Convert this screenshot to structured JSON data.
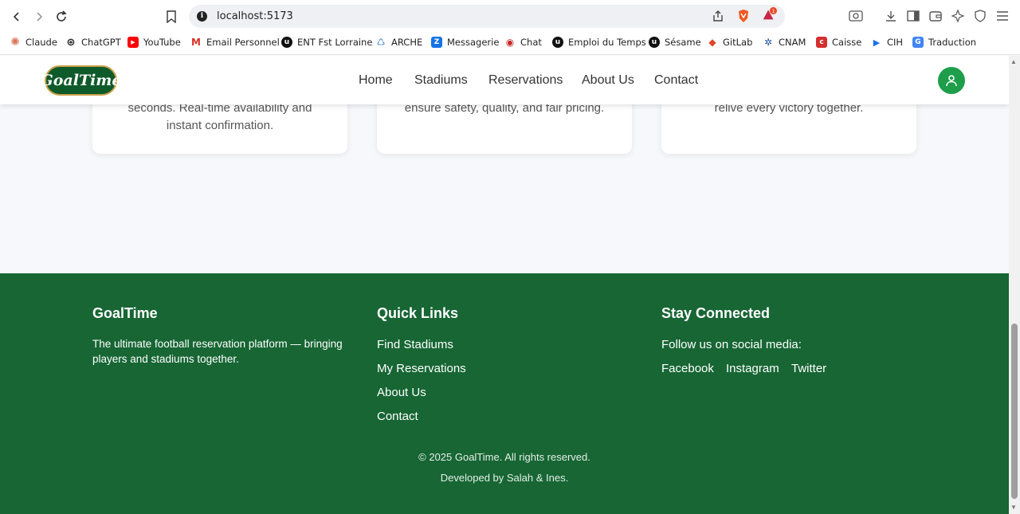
{
  "browser": {
    "url": "localhost:5173",
    "bookmarks": [
      "Claude",
      "ChatGPT",
      "YouTube",
      "Email Personnel",
      "ENT Fst Lorraine",
      "ARCHE",
      "Messagerie",
      "Chat",
      "Emploi du Temps",
      "Sésame",
      "GitLab",
      "CNAM",
      "Caisse",
      "CIH",
      "Traduction"
    ]
  },
  "header": {
    "logo": "GoalTime",
    "nav": [
      "Home",
      "Stadiums",
      "Reservations",
      "About Us",
      "Contact"
    ]
  },
  "cards": [
    {
      "line1": "seconds. Real-time availability and",
      "line2": "instant confirmation."
    },
    {
      "line1": "ensure safety, quality, and fair pricing.",
      "line2": ""
    },
    {
      "line1": "relive every victory together.",
      "line2": ""
    }
  ],
  "footer": {
    "brand": {
      "title": "GoalTime",
      "text1": "The ultimate football reservation platform — bringing",
      "text2": "players and stadiums together."
    },
    "quick_links": {
      "title": "Quick Links",
      "items": [
        "Find Stadiums",
        "My Reservations",
        "About Us",
        "Contact"
      ]
    },
    "social": {
      "title": "Stay Connected",
      "text": "Follow us on social media:",
      "items": [
        "Facebook",
        "Instagram",
        "Twitter"
      ]
    },
    "copyright": "© 2025 GoalTime. All rights reserved.",
    "credit": "Developed by Salah & Ines."
  },
  "colors": {
    "footer": "#176634",
    "accent": "#1e9e4a"
  }
}
